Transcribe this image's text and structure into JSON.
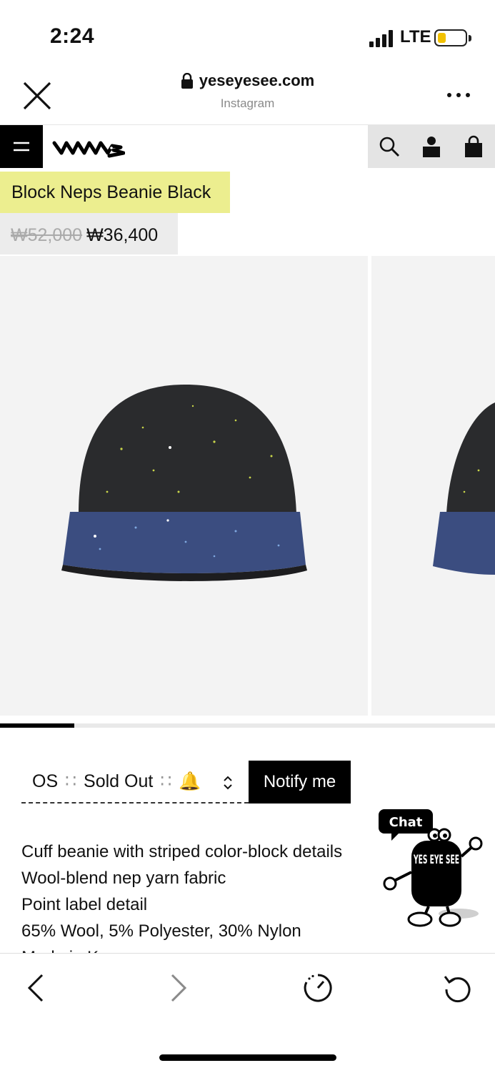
{
  "status_bar": {
    "time": "2:24",
    "network": "LTE",
    "battery_level": 0.3,
    "battery_color": "#f2c100"
  },
  "browser": {
    "url": "yeseyesee.com",
    "source": "Instagram"
  },
  "site_nav": {
    "logo_name": "yeseyesee-logo"
  },
  "product": {
    "title": "Block Neps Beanie Black",
    "original_price": "₩52,000",
    "sale_price": "₩36,400",
    "title_bg": "#ecee8f"
  },
  "gallery": {
    "progress": 0.15
  },
  "variant": {
    "size": "OS",
    "separator": "∷",
    "stock": "Sold Out",
    "bell": "🔔"
  },
  "notify_label": "Notify me",
  "description": [
    "Cuff beanie with striped color-block details",
    "Wool-blend nep yarn fabric",
    "Point label detail",
    "65% Wool, 5% Polyester, 30% Nylon",
    "Made in Korea"
  ],
  "chat_widget": {
    "label": "Chat",
    "mascot_text": "YES EYE SEE"
  }
}
